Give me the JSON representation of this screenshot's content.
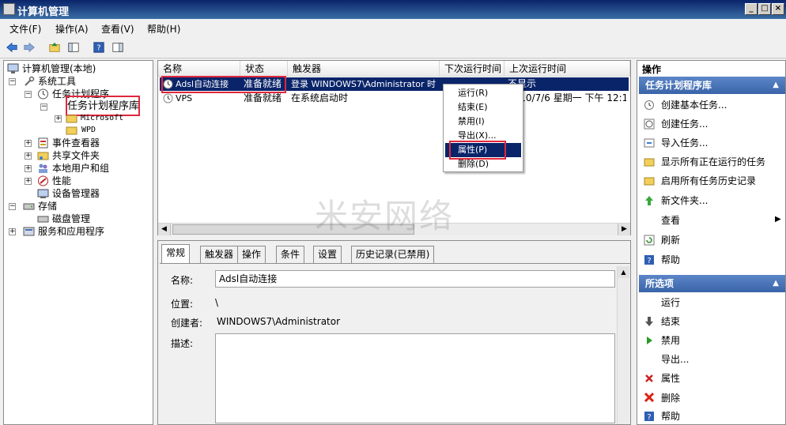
{
  "window": {
    "title": "计算机管理"
  },
  "menubar": [
    "文件(F)",
    "操作(A)",
    "查看(V)",
    "帮助(H)"
  ],
  "tree": {
    "root": "计算机管理(本地)",
    "system_tools": "系统工具",
    "task_scheduler": "任务计划程序",
    "task_library": "任务计划程序库",
    "microsoft": "Microsoft",
    "wpd": "WPD",
    "event_viewer": "事件查看器",
    "shared_folders": "共享文件夹",
    "local_users": "本地用户和组",
    "performance": "性能",
    "device_manager": "设备管理器",
    "storage": "存储",
    "disk_mgmt": "磁盘管理",
    "services_apps": "服务和应用程序"
  },
  "list": {
    "columns": [
      "名称",
      "状态",
      "触发器",
      "下次运行时间",
      "上次运行时间"
    ],
    "rows": [
      {
        "name": "Adsl自动连接",
        "status": "准备就绪",
        "trigger": "登录 WINDOWS7\\Administrator 时",
        "next": "",
        "last": "不显示"
      },
      {
        "name": "VPS",
        "status": "准备就绪",
        "trigger": "在系统启动时",
        "next": "",
        "last": "2010/7/6 星期一 下午 12:1"
      }
    ]
  },
  "context_menu": [
    "运行(R)",
    "结束(E)",
    "禁用(I)",
    "导出(X)...",
    "属性(P)",
    "删除(D)"
  ],
  "watermark": "米安网络",
  "detail": {
    "tabs": [
      "常规",
      "触发器",
      "操作",
      "条件",
      "设置",
      "历史记录(已禁用)"
    ],
    "name_label": "名称:",
    "name_value": "Adsl自动连接",
    "location_label": "位置:",
    "location_value": "\\",
    "author_label": "创建者:",
    "author_value": "WINDOWS7\\Administrator",
    "desc_label": "描述:"
  },
  "actions": {
    "header": "操作",
    "section1": "任务计划程序库",
    "items1": [
      "创建基本任务...",
      "创建任务...",
      "导入任务...",
      "显示所有正在运行的任务",
      "启用所有任务历史记录",
      "新文件夹...",
      "查看",
      "刷新",
      "帮助"
    ],
    "section2": "所选项",
    "items2": [
      "运行",
      "结束",
      "禁用",
      "导出...",
      "属性",
      "删除",
      "帮助"
    ]
  },
  "colors": {
    "highlight": "#0a246a",
    "red_box": "#e0283c",
    "section_blue": "#3a64a8"
  }
}
